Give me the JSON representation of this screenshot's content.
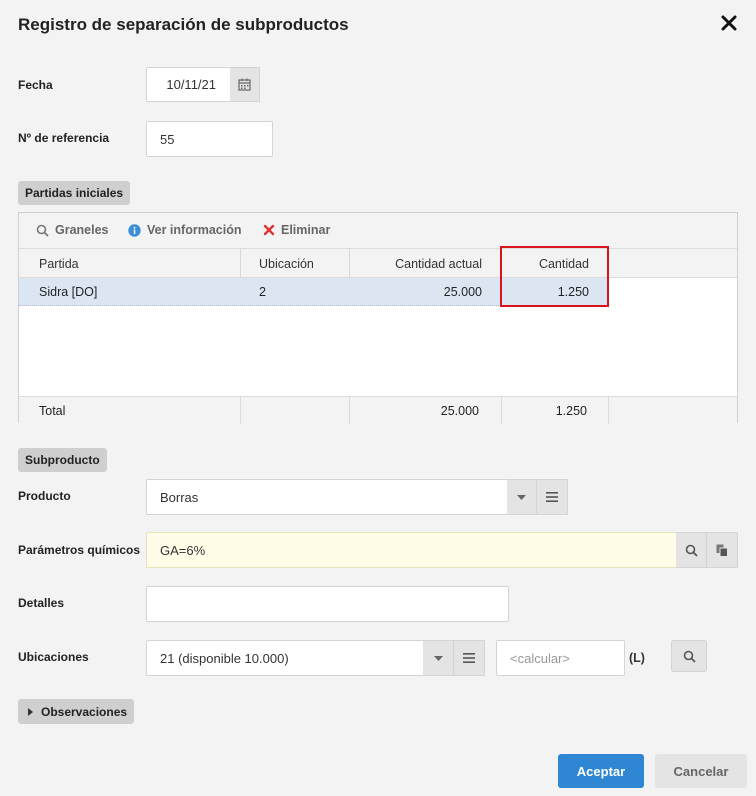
{
  "dialog": {
    "title": "Registro de separación de subproductos"
  },
  "fecha": {
    "label": "Fecha",
    "value": "10/11/21"
  },
  "referencia": {
    "label": "Nº de referencia",
    "value": "55"
  },
  "partidas": {
    "section_label": "Partidas iniciales",
    "toolbar": {
      "graneles": "Graneles",
      "ver_info": "Ver información",
      "eliminar": "Eliminar"
    },
    "columns": [
      "Partida",
      "Ubicación",
      "Cantidad actual",
      "Cantidad"
    ],
    "rows": [
      {
        "partida": "Sidra [DO]",
        "ubicacion": "2",
        "cantidad_actual": "25.000",
        "cantidad": "1.250"
      }
    ],
    "footer": {
      "label": "Total",
      "cantidad_actual": "25.000",
      "cantidad": "1.250"
    }
  },
  "subproducto": {
    "section_label": "Subproducto",
    "producto": {
      "label": "Producto",
      "value": "Borras"
    },
    "parametros": {
      "label": "Parámetros químicos",
      "value": "GA=6%"
    },
    "detalles": {
      "label": "Detalles",
      "value": ""
    },
    "ubicaciones": {
      "label": "Ubicaciones",
      "value": "21 (disponible 10.000)",
      "calc_placeholder": "<calcular>",
      "unit": "(L)"
    }
  },
  "observaciones": {
    "label": "Observaciones"
  },
  "buttons": {
    "accept": "Aceptar",
    "cancel": "Cancelar"
  },
  "colors": {
    "primary": "#2f86d3",
    "highlight": "#d9141c",
    "selected_row": "#dce6f3",
    "yellow_field": "#fffde7"
  }
}
